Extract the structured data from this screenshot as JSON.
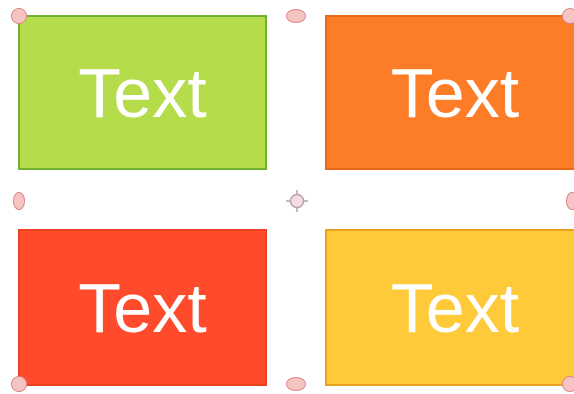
{
  "canvas": {
    "shapes": [
      {
        "label": "Text",
        "fill": "#b5dd4b",
        "border": "#6fb130"
      },
      {
        "label": "Text",
        "fill": "#fd7c28",
        "border": "#e8681a"
      },
      {
        "label": "Text",
        "fill": "#ff4b2b",
        "border": "#e8421f"
      },
      {
        "label": "Text",
        "fill": "#ffca3a",
        "border": "#e8a21f"
      }
    ]
  },
  "selection": {
    "handle_color": "#f7c4c4",
    "handle_border": "#d98787",
    "rotation_handle_color": "#b9a0a7"
  }
}
